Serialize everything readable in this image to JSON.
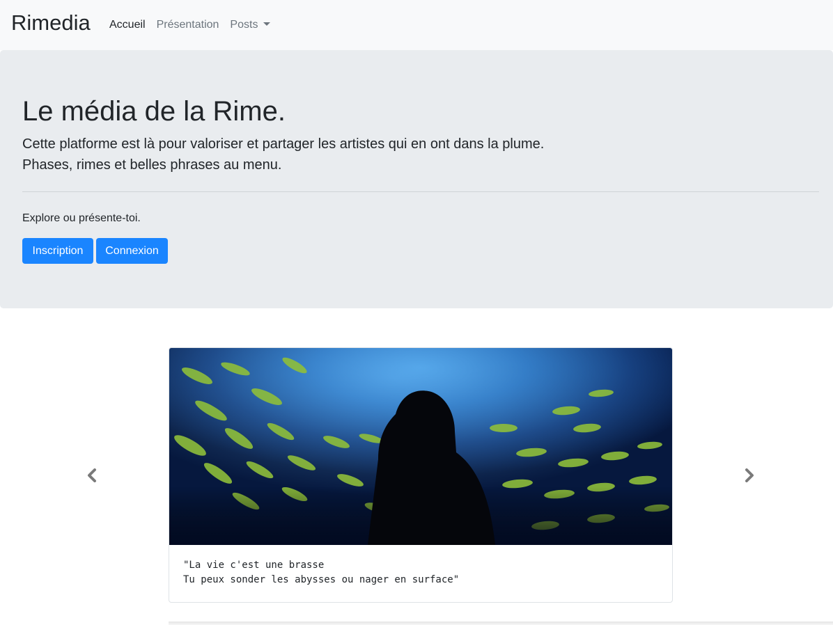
{
  "navbar": {
    "brand": "Rimedia",
    "links": [
      {
        "label": "Accueil"
      },
      {
        "label": "Présentation"
      },
      {
        "label": "Posts"
      }
    ]
  },
  "hero": {
    "title": "Le média de la Rime.",
    "lead_line1": "Cette platforme est là pour valoriser et partager les artistes qui en ont dans la plume.",
    "lead_line2": "Phases, rimes et belles phrases au menu.",
    "sub": "Explore ou présente-toi.",
    "buttons": [
      {
        "label": "Inscription"
      },
      {
        "label": "Connexion"
      }
    ]
  },
  "carousel": {
    "quote_line1": "\"La vie c'est une brasse",
    "quote_line2": "Tu peux sonder les abysses ou nager en surface\"",
    "prev_icon": "chevron-left-icon",
    "next_icon": "chevron-right-icon"
  },
  "colors": {
    "primary": "#1a85ff",
    "navbar_bg": "#f8f9fa",
    "jumbotron_bg": "#e9ecef"
  }
}
